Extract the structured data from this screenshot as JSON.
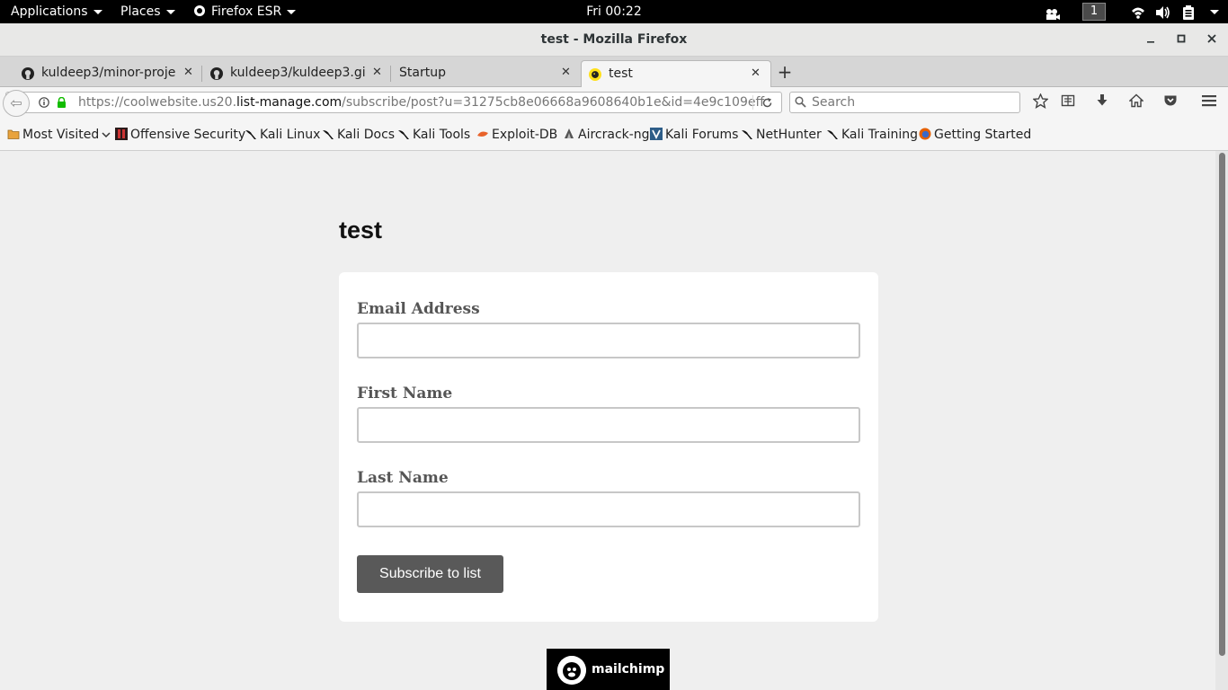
{
  "topbar": {
    "applications": "Applications",
    "places": "Places",
    "browser_menu": "Firefox ESR",
    "clock": "Fri 00:22",
    "workspace": "1"
  },
  "window": {
    "title": "test - Mozilla Firefox"
  },
  "tabs": [
    {
      "label": "kuldeep3/minor-proje…",
      "icon": "github-icon"
    },
    {
      "label": "kuldeep3/kuldeep3.gi…",
      "icon": "github-icon"
    },
    {
      "label": "Startup",
      "icon": ""
    },
    {
      "label": "test",
      "icon": "mailchimp-icon",
      "active": true
    }
  ],
  "navbar": {
    "url_prefix": "https://coolwebsite.us20.",
    "url_host": "list-manage.com",
    "url_suffix": "/subscribe/post?u=31275cb8e06668a9608640b1e&id=4e9c109eff",
    "search_placeholder": "Search"
  },
  "bookmarks": [
    {
      "label": "Most Visited"
    },
    {
      "label": "Offensive Security"
    },
    {
      "label": "Kali Linux"
    },
    {
      "label": "Kali Docs"
    },
    {
      "label": "Kali Tools"
    },
    {
      "label": "Exploit-DB"
    },
    {
      "label": "Aircrack-ng"
    },
    {
      "label": "Kali Forums"
    },
    {
      "label": "NetHunter"
    },
    {
      "label": "Kali Training"
    },
    {
      "label": "Getting Started"
    }
  ],
  "page": {
    "title": "test",
    "fields": [
      {
        "label": "Email Address",
        "value": ""
      },
      {
        "label": "First Name",
        "value": ""
      },
      {
        "label": "Last Name",
        "value": ""
      }
    ],
    "submit_label": "Subscribe to list",
    "footer_logo": "mailchimp"
  }
}
